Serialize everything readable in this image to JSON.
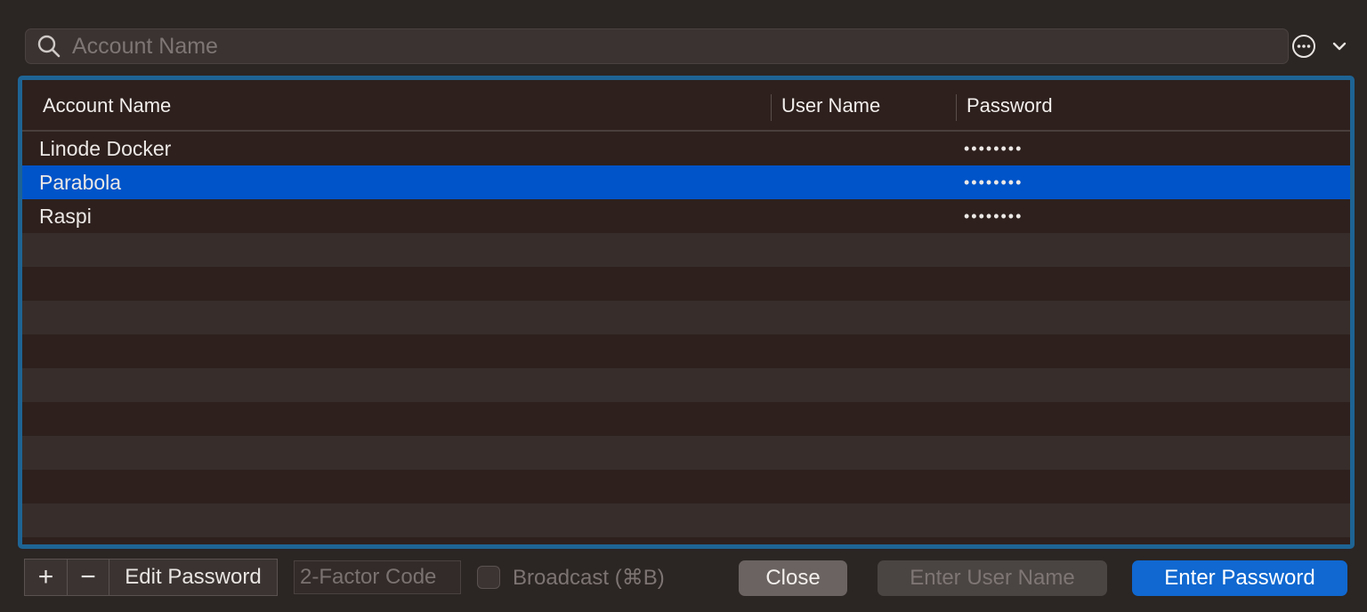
{
  "search": {
    "placeholder": "Account Name",
    "icon": "search-icon"
  },
  "toolbar_icons": {
    "more": "ellipsis-circle-icon",
    "chevron": "chevron-down-icon"
  },
  "colors": {
    "accent": "#1e6494",
    "selection": "#0054c9",
    "primary_button": "#1068d0"
  },
  "table": {
    "headers": [
      "Account Name",
      "User Name",
      "Password"
    ],
    "rows": [
      {
        "account": "Linode Docker",
        "user": "",
        "password": "••••••••"
      },
      {
        "account": "Parabola",
        "user": "",
        "password": "••••••••",
        "selected": true
      },
      {
        "account": "Raspi",
        "user": "",
        "password": "••••••••"
      }
    ]
  },
  "bottom": {
    "add_label": "+",
    "remove_label": "−",
    "edit_label": "Edit Password",
    "twofa_placeholder": "2-Factor Code",
    "broadcast_label": "Broadcast (⌘B)",
    "close_label": "Close",
    "enter_user_label": "Enter User Name",
    "enter_password_label": "Enter Password"
  }
}
